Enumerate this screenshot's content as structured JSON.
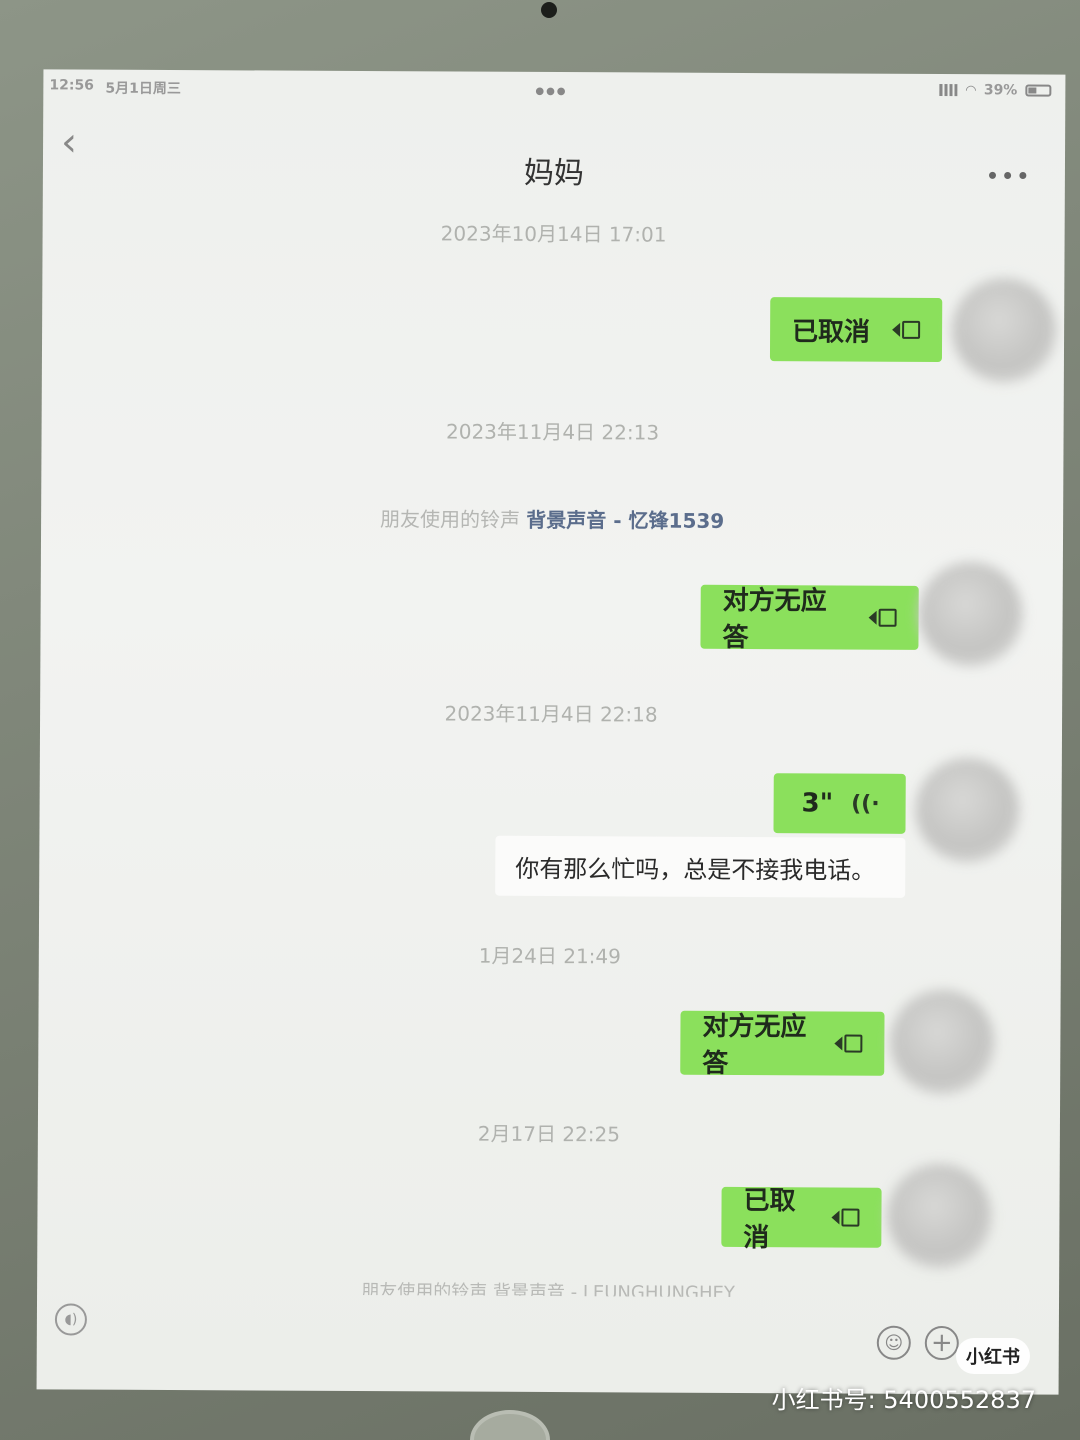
{
  "status_bar": {
    "time": "12:56",
    "date": "5月1日周三",
    "battery": "39%"
  },
  "header": {
    "title": "妈妈"
  },
  "messages": [
    {
      "type": "timestamp",
      "text": "2023年10月14日 17:01"
    },
    {
      "type": "outgoing_call",
      "text": "已取消",
      "icon": "video-call-icon"
    },
    {
      "type": "timestamp",
      "text": "2023年11月4日 22:13"
    },
    {
      "type": "system",
      "prefix": "朋友使用的铃声",
      "link": "背景声音 - 忆锋1539"
    },
    {
      "type": "outgoing_call",
      "text": "对方无应答",
      "icon": "video-call-icon"
    },
    {
      "type": "timestamp",
      "text": "2023年11月4日 22:18"
    },
    {
      "type": "outgoing_voice",
      "duration": "3\"",
      "icon": "voice-wave-icon"
    },
    {
      "type": "transcript",
      "text": "你有那么忙吗，总是不接我电话。"
    },
    {
      "type": "timestamp",
      "text": "1月24日 21:49"
    },
    {
      "type": "outgoing_call",
      "text": "对方无应答",
      "icon": "video-call-icon"
    },
    {
      "type": "timestamp",
      "text": "2月17日 22:25"
    },
    {
      "type": "outgoing_call",
      "text": "已取消",
      "icon": "video-call-icon"
    },
    {
      "type": "system_partial",
      "text": "朋友使用的铃声 背景声音 - LEUNGHUNGHEY"
    }
  ],
  "watermark": {
    "logo": "小红书",
    "id": "小红书号: 5400552837"
  },
  "colors": {
    "bubble_green": "#8be05c",
    "link_blue": "#5b6d8c"
  }
}
